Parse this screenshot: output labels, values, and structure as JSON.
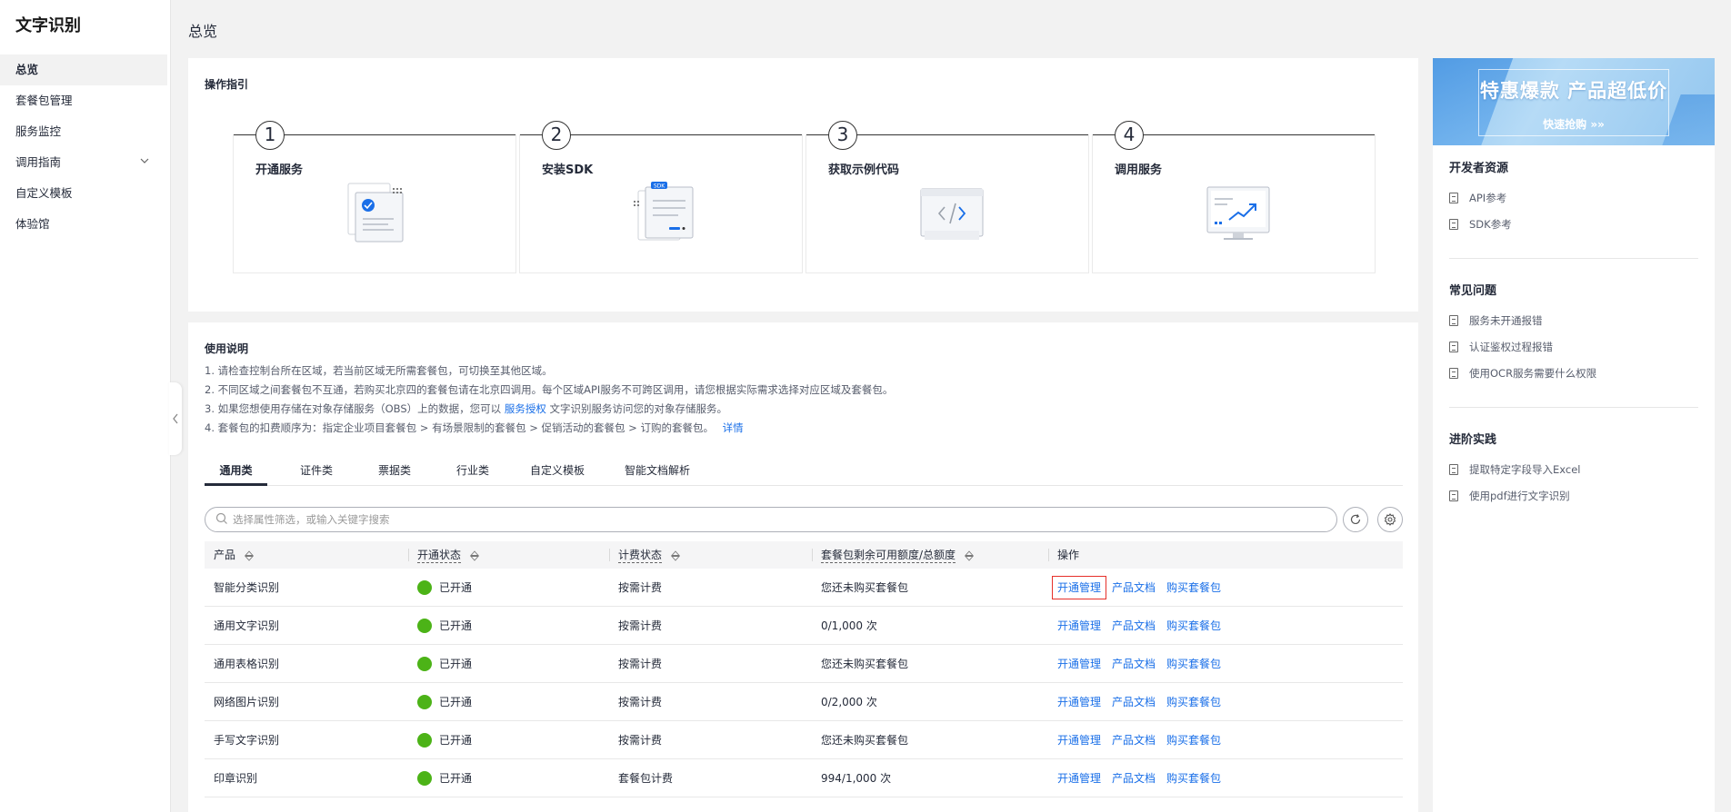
{
  "sidebar": {
    "title": "文字识别",
    "items": [
      {
        "label": "总览"
      },
      {
        "label": "套餐包管理"
      },
      {
        "label": "服务监控"
      },
      {
        "label": "调用指南"
      },
      {
        "label": "自定义模板"
      },
      {
        "label": "体验馆"
      }
    ]
  },
  "page": {
    "title": "总览"
  },
  "guide": {
    "title": "操作指引",
    "steps": [
      {
        "num": "1",
        "label": "开通服务"
      },
      {
        "num": "2",
        "label": "安装SDK"
      },
      {
        "num": "3",
        "label": "获取示例代码"
      },
      {
        "num": "4",
        "label": "调用服务"
      }
    ],
    "sdk_badge": "SDK"
  },
  "usage": {
    "title": "使用说明",
    "note1": "1. 请检查控制台所在区域，若当前区域无所需套餐包，可切换至其他区域。",
    "note2": "2. 不同区域之间套餐包不互通，若购买北京四的套餐包请在北京四调用。每个区域API服务不可跨区调用，请您根据实际需求选择对应区域及套餐包。",
    "note3_pre": "3. 如果您想使用存储在对象存储服务（OBS）上的数据，您可以",
    "note3_link": "服务授权",
    "note3_post": "文字识别服务访问您的对象存储服务。",
    "note4_pre": "4. 套餐包的扣费顺序为：指定企业项目套餐包 > 有场景限制的套餐包 > 促销活动的套餐包 > 订购的套餐包。",
    "note4_link": "详情"
  },
  "tabs": [
    {
      "label": "通用类"
    },
    {
      "label": "证件类"
    },
    {
      "label": "票据类"
    },
    {
      "label": "行业类"
    },
    {
      "label": "自定义模板"
    },
    {
      "label": "智能文档解析"
    }
  ],
  "search": {
    "placeholder": "选择属性筛选，或输入关键字搜索"
  },
  "table": {
    "headers": {
      "product": "产品",
      "status": "开通状态",
      "billing": "计费状态",
      "quota": "套餐包剩余可用额度/总额度",
      "ops": "操作"
    },
    "op_labels": {
      "manage": "开通管理",
      "docs": "产品文档",
      "buy": "购买套餐包"
    },
    "rows": [
      {
        "product": "智能分类识别",
        "status": "已开通",
        "billing": "按需计费",
        "quota": "您还未购买套餐包"
      },
      {
        "product": "通用文字识别",
        "status": "已开通",
        "billing": "按需计费",
        "quota": "0/1,000 次"
      },
      {
        "product": "通用表格识别",
        "status": "已开通",
        "billing": "按需计费",
        "quota": "您还未购买套餐包"
      },
      {
        "product": "网络图片识别",
        "status": "已开通",
        "billing": "按需计费",
        "quota": "0/2,000 次"
      },
      {
        "product": "手写文字识别",
        "status": "已开通",
        "billing": "按需计费",
        "quota": "您还未购买套餐包"
      },
      {
        "product": "印章识别",
        "status": "已开通",
        "billing": "套餐包计费",
        "quota": "994/1,000 次"
      }
    ]
  },
  "right": {
    "banner_title": "特惠爆款 产品超低价",
    "banner_cta": "快速抢购 »»",
    "dev_title": "开发者资源",
    "dev_links": [
      "API参考",
      "SDK参考"
    ],
    "faq_title": "常见问题",
    "faq_links": [
      "服务未开通报错",
      "认证鉴权过程报错",
      "使用OCR服务需要什么权限"
    ],
    "adv_title": "进阶实践",
    "adv_links": [
      "提取特定字段导入Excel",
      "使用pdf进行文字识别"
    ]
  },
  "colors": {
    "status_green": "#4cb317",
    "link": "#1a6fe8",
    "highlight": "#e6302a"
  }
}
